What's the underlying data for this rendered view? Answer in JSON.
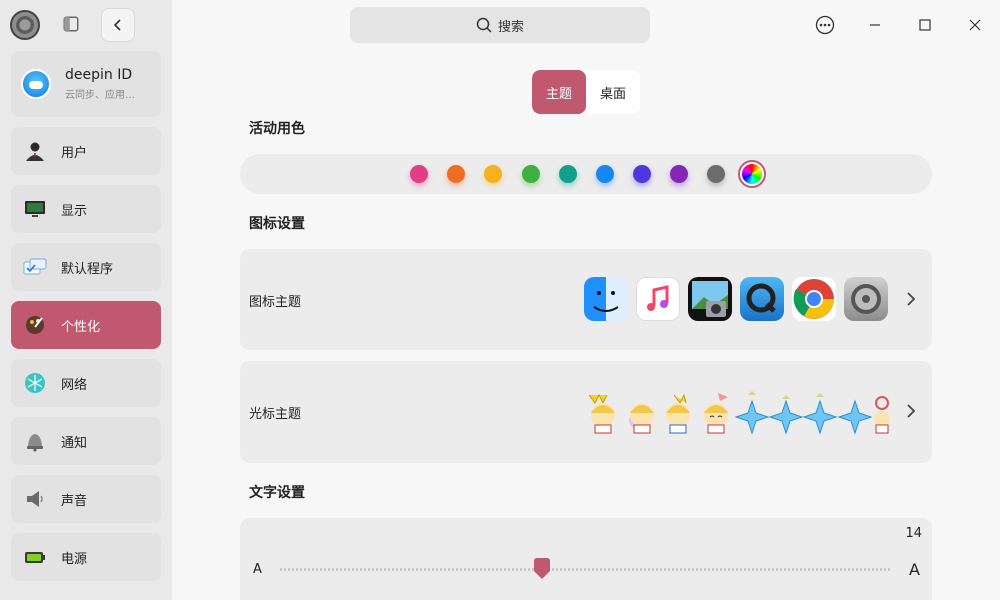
{
  "sidebar": {
    "account": {
      "name": "deepin ID",
      "subtitle": "云同步、应用…"
    },
    "items": [
      {
        "label": "用户",
        "icon": "user-icon"
      },
      {
        "label": "显示",
        "icon": "monitor-icon"
      },
      {
        "label": "默认程序",
        "icon": "default-apps-icon"
      },
      {
        "label": "个性化",
        "icon": "personalization-icon",
        "active": true
      },
      {
        "label": "网络",
        "icon": "network-icon"
      },
      {
        "label": "通知",
        "icon": "bell-icon"
      },
      {
        "label": "声音",
        "icon": "speaker-icon"
      },
      {
        "label": "电源",
        "icon": "battery-icon"
      }
    ]
  },
  "search": {
    "placeholder": "搜索"
  },
  "tabs": [
    {
      "label": "主题",
      "active": true
    },
    {
      "label": "桌面",
      "active": false
    }
  ],
  "accent": {
    "title": "活动用色",
    "colors": [
      "#e23d85",
      "#ee6d24",
      "#f5b21a",
      "#3eb13f",
      "#12a08a",
      "#1586f2",
      "#4c38de",
      "#8526b9",
      "#6c6c6c"
    ],
    "selected": "multicolor"
  },
  "icon_settings": {
    "title": "图标设置",
    "icon_theme_label": "图标主题",
    "cursor_theme_label": "光标主题"
  },
  "text_settings": {
    "title": "文字设置",
    "font_size": "14",
    "small_label": "A",
    "large_label": "A"
  },
  "brand_color": "#c0596f"
}
